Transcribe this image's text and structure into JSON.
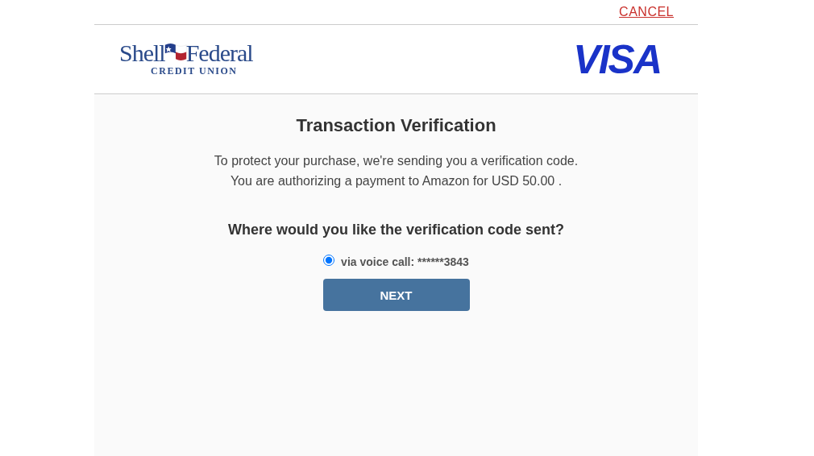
{
  "cancel_link": "CANCEL",
  "header": {
    "bank_logo": {
      "word_1": "Shell",
      "word_2": "Federal",
      "subtitle": "CREDIT UNION"
    },
    "card_logo": "VISA"
  },
  "title": "Transaction Verification",
  "message": [
    "To protect your purchase, we're sending you a verification code.",
    "You are authorizing a payment to Amazon for USD 50.00 ."
  ],
  "question": "Where would you like the verification code sent?",
  "options": [
    {
      "label": "via voice call: ******3843",
      "selected": true
    }
  ],
  "next_button": "NEXT"
}
